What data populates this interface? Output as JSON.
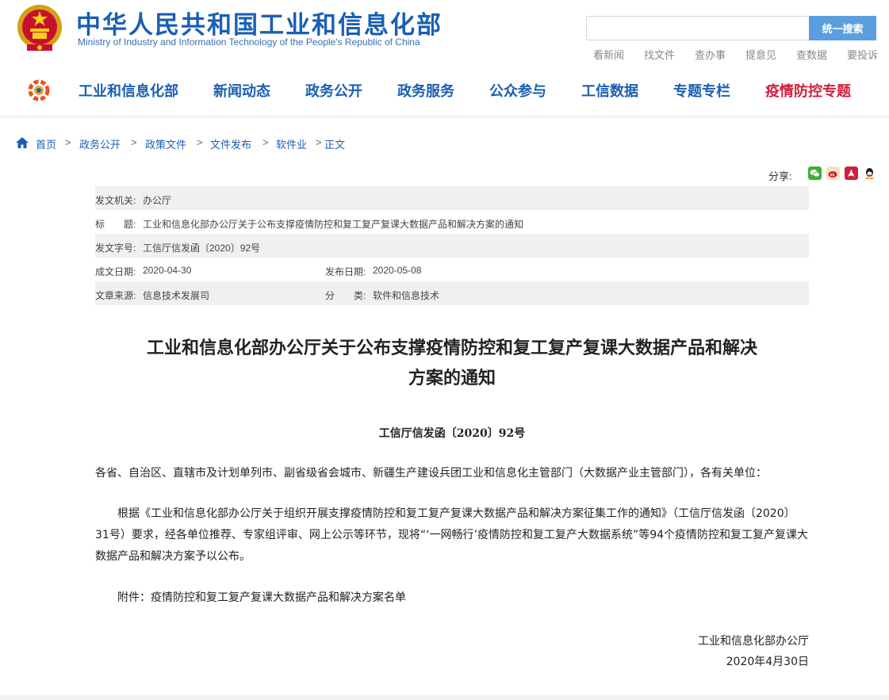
{
  "header": {
    "title_cn": "中华人民共和国工业和信息化部",
    "title_en": "Ministry of Industry and Information Technology of the People's Republic of China",
    "search": {
      "placeholder": "",
      "button_label": "统一搜索"
    },
    "quick_links": [
      "看新闻",
      "找文件",
      "查办事",
      "提意见",
      "查数据",
      "要投诉"
    ]
  },
  "nav": {
    "items": [
      "工业和信息化部",
      "新闻动态",
      "政务公开",
      "政务服务",
      "公众参与",
      "工信数据",
      "专题专栏",
      "疫情防控专题"
    ]
  },
  "breadcrumb": {
    "items": [
      "首页",
      "政务公开",
      "政策文件",
      "文件发布",
      "软件业",
      "正文"
    ],
    "separator": ">"
  },
  "share": {
    "label": "分享:",
    "icons": [
      "wechat-icon",
      "weibo-icon",
      "pdf-icon",
      "qq-icon"
    ],
    "colors": {
      "wechat": "#3cb034",
      "weibo": "#e6162d",
      "pdf": "#d0203c",
      "qq": "#1e90ff"
    }
  },
  "meta": {
    "issuer_label": "发文机关:",
    "issuer": "办公厅",
    "title_label": "标　　题:",
    "title": "工业和信息化部办公厅关于公布支撑疫情防控和复工复产复课大数据产品和解决方案的通知",
    "doc_no_label": "发文字号:",
    "doc_no": "工信厅信发函〔2020〕92号",
    "created_label": "成文日期:",
    "created": "2020-04-30",
    "published_label": "发布日期:",
    "published": "2020-05-08",
    "source_label": "文章来源:",
    "source": "信息技术发展司",
    "category_label": "分　　类:",
    "category": "软件和信息技术"
  },
  "article": {
    "title_line1": "工业和信息化部办公厅关于公布支撑疫情防控和复工复产复课大数据产品和解决",
    "title_line2": "方案的通知",
    "doc_no": "工信厅信发函〔2020〕92号",
    "greeting": "各省、自治区、直辖市及计划单列市、副省级省会城市、新疆生产建设兵团工业和信息化主管部门（大数据产业主管部门），各有关单位：",
    "body": "根据《工业和信息化部办公厅关于组织开展支撑疫情防控和复工复产复课大数据产品和解决方案征集工作的通知》（工信厅信发函〔2020〕31号）要求，经各单位推荐、专家组评审、网上公示等环节，现将“‘一网畅行’疫情防控和复工复产大数据系统”等94个疫情防控和复工复产复课大数据产品和解决方案予以公布。",
    "attachment": "附件：疫情防控和复工复产复课大数据产品和解决方案名单",
    "signer": "工业和信息化部办公厅",
    "date": "2020年4月30日"
  },
  "colors": {
    "brand_blue": "#1a5fb4",
    "special_red": "#d0203c",
    "search_button": "#5a9ee0",
    "meta_shade": "#f0f0f0"
  }
}
